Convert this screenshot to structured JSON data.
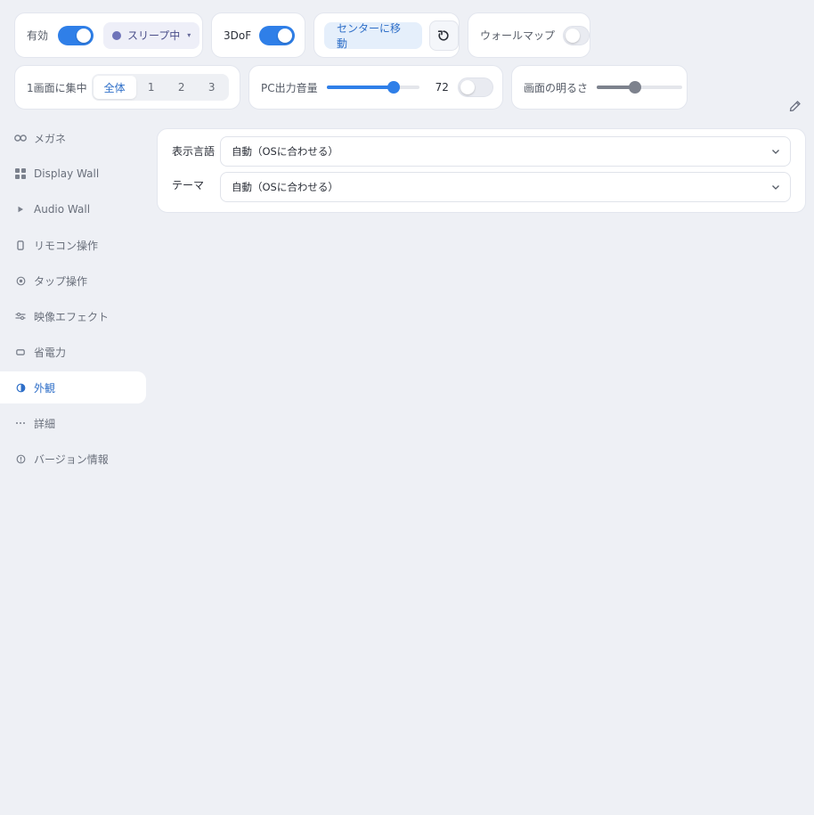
{
  "toolbar": {
    "enabled_label": "有効",
    "sleep_label": "スリープ中",
    "sleep_caret": "▾",
    "dof_label": "3DoF",
    "center_label": "センターに移動",
    "wallmap_label": "ウォールマップ",
    "focus_label": "1画面に集中",
    "focus_options": [
      "全体",
      "1",
      "2",
      "3"
    ],
    "focus_selected": "全体",
    "volume_label": "PC出力音量",
    "volume_value": "72",
    "volume_level": 0.72,
    "brightness_label": "画面の明るさ",
    "brightness_level": 0.45
  },
  "toggles": {
    "enabled": true,
    "dof": true,
    "wallmap": false,
    "volume_mute": false
  },
  "sidebar": {
    "items": [
      {
        "label": "メガネ",
        "icon": "glasses-icon"
      },
      {
        "label": "Display Wall",
        "icon": "grid-icon"
      },
      {
        "label": "Audio Wall",
        "icon": "play-icon"
      },
      {
        "label": "リモコン操作",
        "icon": "remote-icon"
      },
      {
        "label": "タップ操作",
        "icon": "tap-icon"
      },
      {
        "label": "映像エフェクト",
        "icon": "sliders-icon"
      },
      {
        "label": "省電力",
        "icon": "battery-icon"
      },
      {
        "label": "外観",
        "icon": "contrast-icon",
        "active": true
      },
      {
        "label": "詳細",
        "icon": "more-icon"
      },
      {
        "label": "バージョン情報",
        "icon": "info-icon"
      }
    ]
  },
  "appearance": {
    "language_label": "表示言語",
    "language_value": "自動（OSに合わせる）",
    "theme_label": "テーマ",
    "theme_value": "自動（OSに合わせる）"
  },
  "colors": {
    "accent": "#2f7fe8",
    "background": "#eef0f5",
    "sleep_dot": "#6f74b9"
  }
}
